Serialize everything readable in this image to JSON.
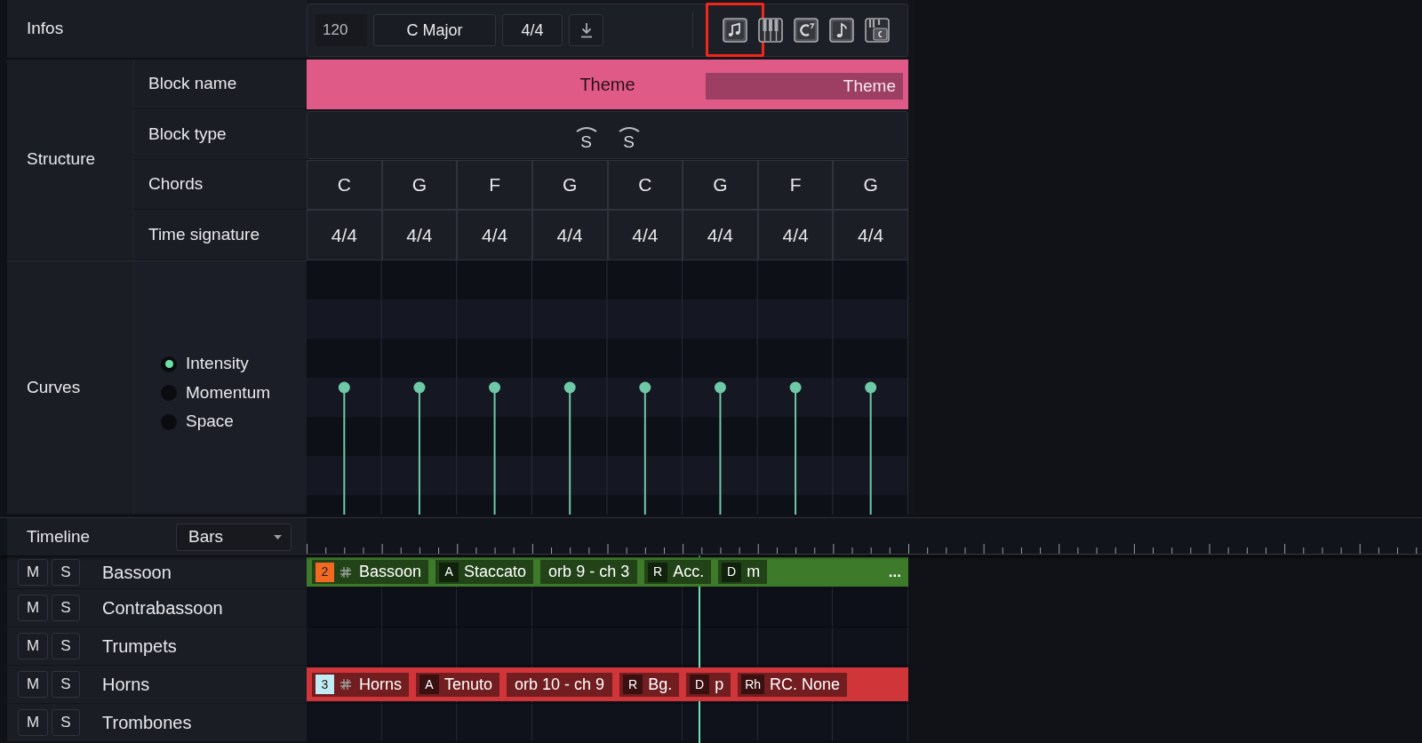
{
  "infos": {
    "label": "Infos",
    "tempo": "120",
    "key": "C Major",
    "time_signature": "4/4",
    "tools": [
      {
        "kind": "notes",
        "highlighted": true
      },
      {
        "kind": "piano",
        "highlighted": false
      },
      {
        "kind": "chord",
        "highlighted": false
      },
      {
        "kind": "note",
        "highlighted": false
      },
      {
        "kind": "keys-chord",
        "highlighted": false
      }
    ]
  },
  "structure": {
    "label": "Structure",
    "block_name": {
      "label": "Block name",
      "value": "Theme",
      "tag": "Theme"
    },
    "block_type": {
      "label": "Block type",
      "markers": [
        "S",
        "S"
      ]
    },
    "chords": {
      "label": "Chords",
      "cells": [
        "C",
        "G",
        "F",
        "G",
        "C",
        "G",
        "F",
        "G"
      ]
    },
    "time_signature": {
      "label": "Time signature",
      "cells": [
        "4/4",
        "4/4",
        "4/4",
        "4/4",
        "4/4",
        "4/4",
        "4/4",
        "4/4"
      ]
    }
  },
  "curves": {
    "label": "Curves",
    "options": [
      {
        "label": "Intensity",
        "selected": true
      },
      {
        "label": "Momentum",
        "selected": false
      },
      {
        "label": "Space",
        "selected": false
      }
    ]
  },
  "timeline": {
    "label": "Timeline",
    "mode": "Bars"
  },
  "tracks": [
    {
      "name": "Bassoon",
      "mute": "M",
      "solo": "S",
      "clip": {
        "color": "#3d7a2a",
        "badge": {
          "text": "2",
          "color": "#f26a21"
        },
        "name": "Bassoon",
        "segments": [
          {
            "kind": "tagged",
            "tag": "A",
            "text": "Staccato"
          },
          {
            "kind": "plain",
            "text": "orb 9 - ch 3"
          },
          {
            "kind": "tagged",
            "tag": "R",
            "text": "Acc."
          },
          {
            "kind": "tagged",
            "tag": "D",
            "text": "m"
          }
        ],
        "more": "..."
      }
    },
    {
      "name": "Contrabassoon",
      "mute": "M",
      "solo": "S"
    },
    {
      "name": "Trumpets",
      "mute": "M",
      "solo": "S"
    },
    {
      "name": "Horns",
      "mute": "M",
      "solo": "S",
      "clip": {
        "color": "#d0353a",
        "badge": {
          "text": "3",
          "color": "#c2ecf4"
        },
        "name": "Horns",
        "segments": [
          {
            "kind": "tagged",
            "tag": "A",
            "text": "Tenuto"
          },
          {
            "kind": "plain",
            "text": "orb 10 - ch 9"
          },
          {
            "kind": "tagged",
            "tag": "R",
            "text": "Bg."
          },
          {
            "kind": "tagged",
            "tag": "D",
            "text": "p"
          },
          {
            "kind": "tagged",
            "tag": "Rh",
            "text": "RC. None"
          }
        ]
      }
    },
    {
      "name": "Trombones",
      "mute": "M",
      "solo": "S"
    }
  ]
}
